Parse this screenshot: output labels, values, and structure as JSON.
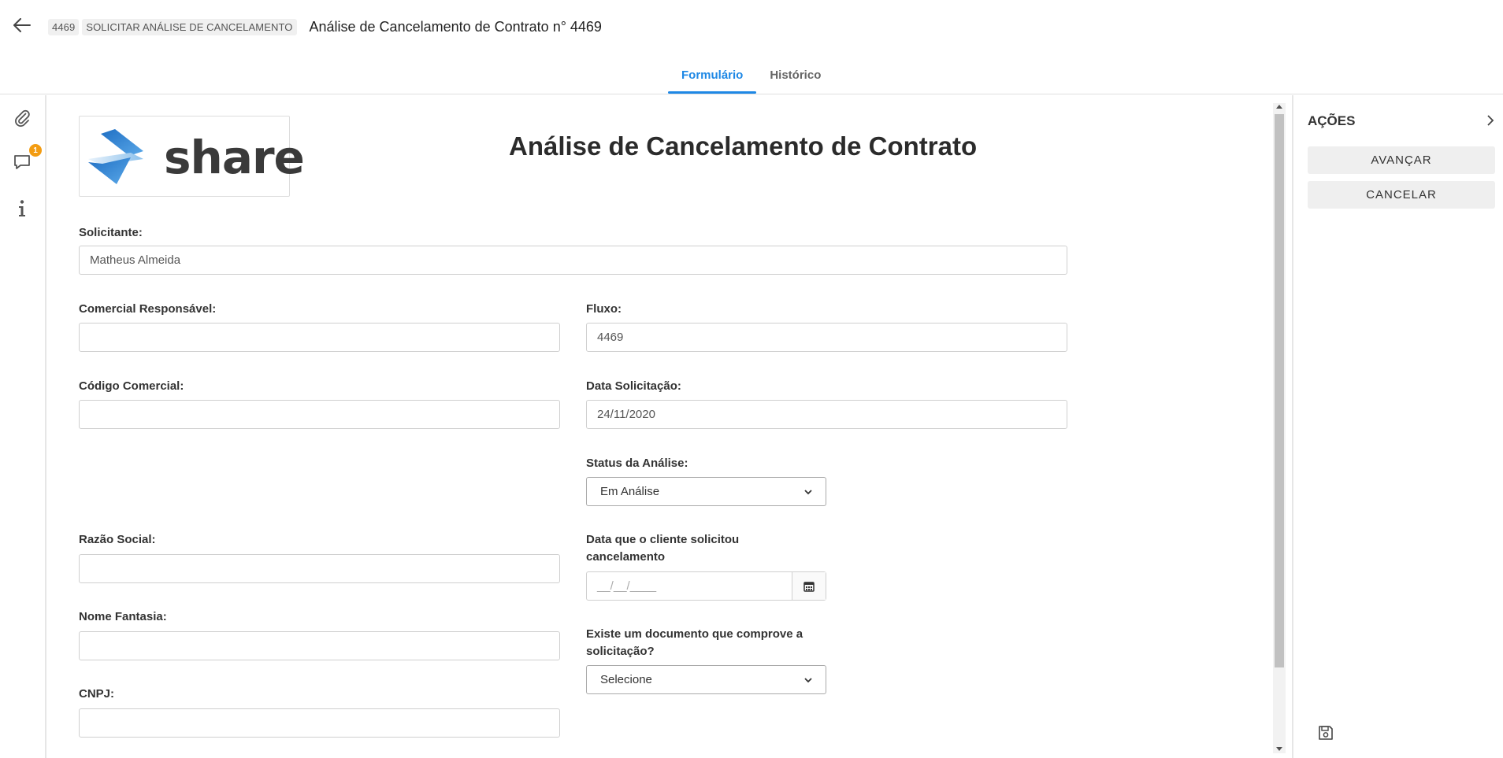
{
  "header": {
    "crumb_id": "4469",
    "crumb_task": "SOLICITAR ANÁLISE DE CANCELAMENTO",
    "title": "Análise de Cancelamento de Contrato n° 4469"
  },
  "tabs": [
    {
      "label": "Formulário",
      "active": true
    },
    {
      "label": "Histórico",
      "active": false
    }
  ],
  "sidebar": {
    "comments_badge": "1",
    "icons": [
      "paperclip-icon",
      "comment-icon",
      "info-icon"
    ]
  },
  "form": {
    "logo_text": "share",
    "title": "Análise de Cancelamento de Contrato",
    "solicitante_label": "Solicitante:",
    "solicitante_value": "Matheus Almeida",
    "comercial_label": "Comercial Responsável:",
    "comercial_value": "",
    "fluxo_label": "Fluxo:",
    "fluxo_value": "4469",
    "codigo_label": "Código Comercial:",
    "codigo_value": "",
    "data_solicitacao_label": "Data Solicitação:",
    "data_solicitacao_value": "24/11/2020",
    "status_label": "Status da Análise:",
    "status_value": "Em Análise",
    "razao_label": "Razão Social:",
    "razao_value": "",
    "data_cliente_label_1": "Data que o cliente solicitou",
    "data_cliente_label_2": "cancelamento",
    "data_cliente_placeholder": "__/__/____",
    "fantasia_label": "Nome Fantasia:",
    "fantasia_value": "",
    "documento_label_1": "Existe um documento que comprove a",
    "documento_label_2": "solicitação?",
    "documento_value": "Selecione",
    "cnpj_label": "CNPJ:",
    "cnpj_value": ""
  },
  "actions": {
    "title": "AÇÕES",
    "advance_label": "AVANÇAR",
    "cancel_label": "CANCELAR"
  },
  "colors": {
    "accent": "#1e88e5",
    "badge": "#f39c12",
    "logo_blue": "#2f7fd0"
  }
}
